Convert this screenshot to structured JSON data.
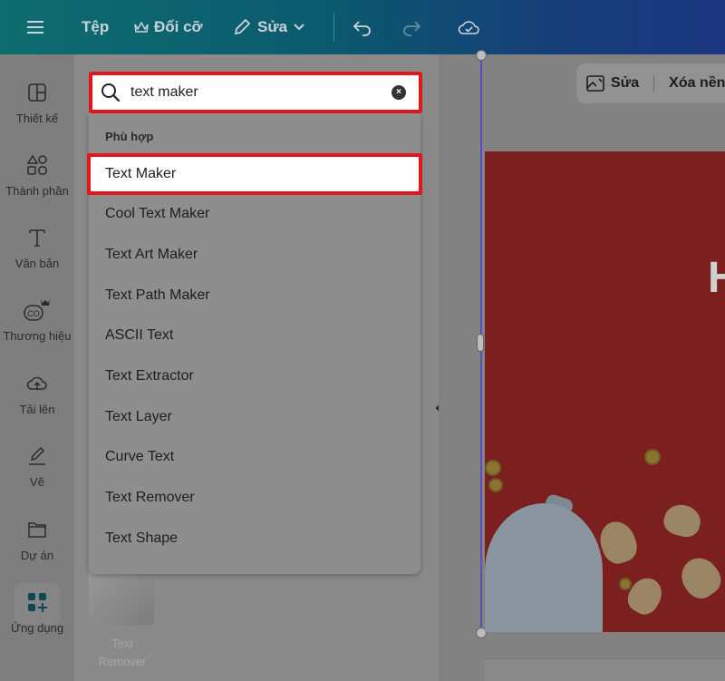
{
  "header": {
    "file_label": "Tệp",
    "resize_label": "Đổi cỡ",
    "edit_label": "Sửa",
    "icons": [
      "menu-icon",
      "crown-icon",
      "pencil-icon",
      "chevron-down-icon",
      "undo-icon",
      "redo-icon",
      "cloud-icon"
    ]
  },
  "sidebar": {
    "items": [
      {
        "label": "Thiết kế",
        "icon": "layout-icon"
      },
      {
        "label": "Thành phần",
        "icon": "elements-icon"
      },
      {
        "label": "Văn bản",
        "icon": "text-icon"
      },
      {
        "label": "Thương hiệu",
        "icon": "brand-icon"
      },
      {
        "label": "Tải lên",
        "icon": "upload-icon"
      },
      {
        "label": "Vẽ",
        "icon": "draw-icon"
      },
      {
        "label": "Dự án",
        "icon": "folder-icon"
      },
      {
        "label": "Ứng dụng",
        "icon": "apps-icon"
      }
    ]
  },
  "search": {
    "value": "text maker",
    "clear_symbol": "×"
  },
  "dropdown": {
    "heading": "Phù hợp",
    "items": [
      "Text Maker",
      "Cool Text Maker",
      "Text Art Maker",
      "Text Path Maker",
      "ASCII Text",
      "Text Extractor",
      "Text Layer",
      "Curve Text",
      "Text Remover",
      "Text Shape"
    ],
    "highlighted_index": 0
  },
  "panel": {
    "thumbnail_label_line1": "Text",
    "thumbnail_label_line2": "Remover"
  },
  "toolbar": {
    "edit_label": "Sửa",
    "remove_bg_label": "Xóa nền"
  },
  "canvas": {
    "visible_glyph": "H"
  },
  "colors": {
    "highlight_border": "#e3171b",
    "topbar_start": "#0e6d6f",
    "topbar_end": "#1b3680",
    "selection_line": "#5a4fb8"
  }
}
